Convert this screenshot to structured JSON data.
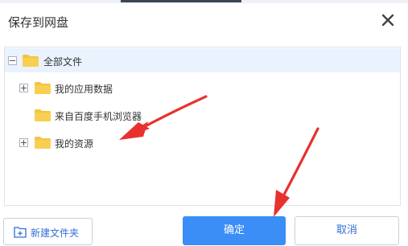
{
  "dialog": {
    "title": "保存到网盘",
    "close_icon": "close-icon"
  },
  "tree": {
    "items": [
      {
        "label": "全部文件",
        "expanded": true,
        "selected": true,
        "icon": "folder-icon"
      },
      {
        "label": "我的应用数据",
        "expanded": false,
        "icon": "folder-icon"
      },
      {
        "label": "来自百度手机浏览器",
        "icon": "folder-icon"
      },
      {
        "label": "我的资源",
        "expanded": false,
        "icon": "folder-icon"
      }
    ]
  },
  "buttons": {
    "new_folder": "新建文件夹",
    "ok": "确定",
    "cancel": "取消"
  },
  "colors": {
    "folder": "#f5c343",
    "primary": "#3a8ef6",
    "selected_row": "#e9f2fd",
    "annotation_arrow": "#e8312f"
  }
}
